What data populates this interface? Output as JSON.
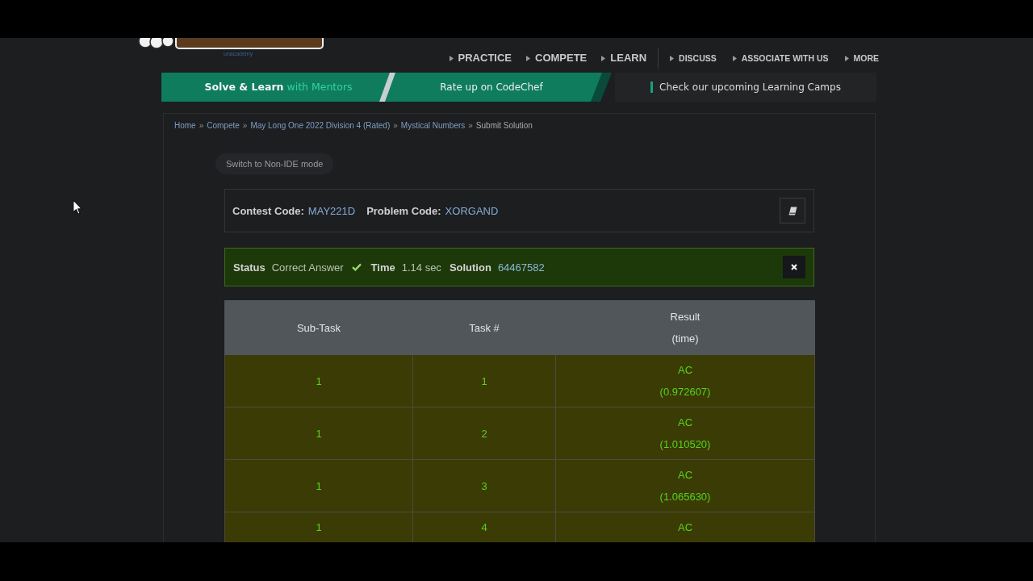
{
  "header": {
    "logo_subtext": "unacademy",
    "nav": [
      {
        "label": "PRACTICE",
        "kind": "primary"
      },
      {
        "label": "COMPETE",
        "kind": "primary"
      },
      {
        "label": "LEARN",
        "kind": "primary"
      },
      {
        "label": "DISCUSS",
        "kind": "secondary"
      },
      {
        "label": "ASSOCIATE WITH US",
        "kind": "secondary"
      },
      {
        "label": "MORE",
        "kind": "secondary"
      }
    ]
  },
  "banner": [
    {
      "kind": "lead",
      "text": "**Solve & Learn** with Mentors"
    },
    {
      "kind": "promo",
      "text": "Rate up on CodeChef"
    },
    {
      "kind": "notice",
      "text": "Check our upcoming Learning Camps"
    }
  ],
  "breadcrumb": [
    {
      "kind": "link",
      "text": "Home"
    },
    {
      "kind": "separator",
      "text": "»"
    },
    {
      "kind": "link",
      "text": "Compete"
    },
    {
      "kind": "separator",
      "text": "»"
    },
    {
      "kind": "link",
      "text": "May Long One 2022 Division 4 (Rated)"
    },
    {
      "kind": "separator",
      "text": "»"
    },
    {
      "kind": "link",
      "text": "Mystical Numbers"
    },
    {
      "kind": "separator",
      "text": "»"
    },
    {
      "kind": "current",
      "text": "Submit Solution"
    }
  ],
  "mode_button": {
    "label": "Switch to Non-IDE mode"
  },
  "problem_info": {
    "fields": [
      {
        "label": "Contest Code:",
        "value": "MAY221D"
      },
      {
        "label": "Problem Code:",
        "value": "XORGAND"
      }
    ]
  },
  "status_bar": {
    "accepted": true,
    "fields": [
      {
        "kind": "verdict",
        "label": "Status",
        "value": "Correct Answer"
      },
      {
        "kind": "plain",
        "label": "Time",
        "value": "1.14 sec"
      },
      {
        "kind": "link",
        "label": "Solution",
        "value": "64467582"
      }
    ]
  },
  "table": {
    "columns": [
      {
        "label": "Sub-Task"
      },
      {
        "label": "Task #"
      },
      {
        "label": "Result",
        "sublabel": "(time)"
      }
    ],
    "rows": [
      {
        "subtask": "1",
        "task": "1",
        "result": "AC",
        "time": "(0.972607)"
      },
      {
        "subtask": "1",
        "task": "2",
        "result": "AC",
        "time": "(1.010520)"
      },
      {
        "subtask": "1",
        "task": "3",
        "result": "AC",
        "time": "(1.065630)"
      },
      {
        "subtask": "1",
        "task": "4",
        "result": "AC"
      }
    ]
  }
}
